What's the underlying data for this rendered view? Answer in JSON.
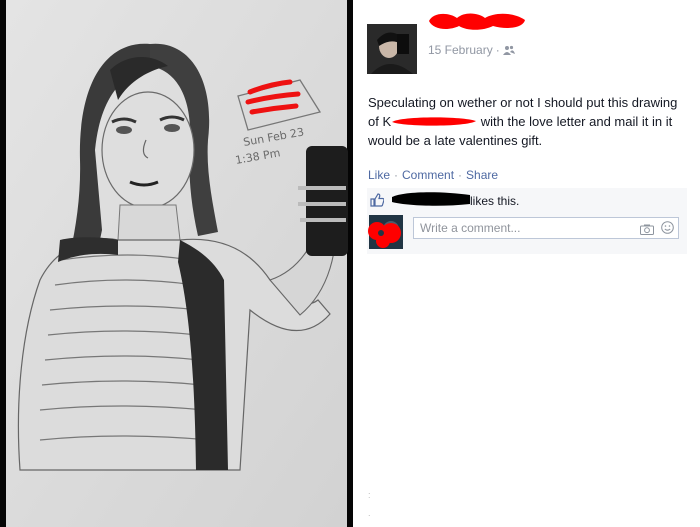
{
  "post": {
    "date": "15 February",
    "text_part1": "Speculating on wether or not I should put this drawing",
    "text_part2_prefix": "of K",
    "text_part2_suffix": " with the love letter and mail it in it",
    "text_part3": "would be a late valentines gift."
  },
  "actions": {
    "like": "Like",
    "comment": "Comment",
    "share": "Share"
  },
  "likes": {
    "text": "likes this."
  },
  "comment": {
    "placeholder": "Write a comment..."
  },
  "drawing": {
    "sign_line1": "Sun Feb 23",
    "sign_line2": "1:38 Pm"
  },
  "colors": {
    "link": "#4e69a2",
    "muted": "#9197a3",
    "redaction": "#ff0000"
  },
  "icons": [
    "audience-friends-icon",
    "like-thumb-icon",
    "camera-icon",
    "emoji-icon"
  ]
}
